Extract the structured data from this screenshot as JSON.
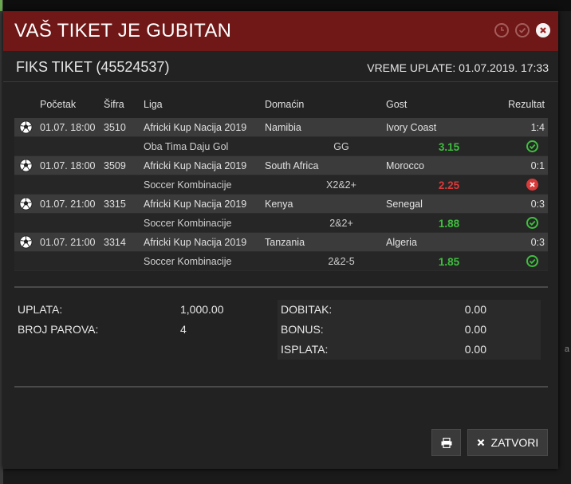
{
  "modal": {
    "title": "VAŠ TIKET JE GUBITAN",
    "ticket_label": "FIKS TIKET (45524537)",
    "payment_time": "VREME UPLATE: 01.07.2019. 17:33"
  },
  "header_icons": [
    "clock-icon",
    "check-circle-icon",
    "close-icon"
  ],
  "table": {
    "columns": {
      "start": "Početak",
      "code": "Šifra",
      "league": "Liga",
      "home": "Domaćin",
      "away": "Gost",
      "result": "Rezultat"
    },
    "matches": [
      {
        "start": "01.07. 18:00",
        "code": "3510",
        "league": "Africki Kup Nacija 2019",
        "home": "Namibia",
        "away": "Ivory Coast",
        "result": "1:4",
        "market": "Oba Tima Daju Gol",
        "tip": "GG",
        "odd": "3.15",
        "status": "win"
      },
      {
        "start": "01.07. 18:00",
        "code": "3509",
        "league": "Africki Kup Nacija 2019",
        "home": "South Africa",
        "away": "Morocco",
        "result": "0:1",
        "market": "Soccer Kombinacije",
        "tip": "X2&2+",
        "odd": "2.25",
        "status": "lose"
      },
      {
        "start": "01.07. 21:00",
        "code": "3315",
        "league": "Africki Kup Nacija 2019",
        "home": "Kenya",
        "away": "Senegal",
        "result": "0:3",
        "market": "Soccer Kombinacije",
        "tip": "2&2+",
        "odd": "1.88",
        "status": "win"
      },
      {
        "start": "01.07. 21:00",
        "code": "3314",
        "league": "Africki Kup Nacija 2019",
        "home": "Tanzania",
        "away": "Algeria",
        "result": "0:3",
        "market": "Soccer Kombinacije",
        "tip": "2&2-5",
        "odd": "1.85",
        "status": "win"
      }
    ]
  },
  "summary": {
    "stake_label": "UPLATA:",
    "stake_value": "1,000.00",
    "pairs_label": "BROJ PAROVA:",
    "pairs_value": "4",
    "win_label": "DOBITAK:",
    "win_value": "0.00",
    "bonus_label": "BONUS:",
    "bonus_value": "0.00",
    "payout_label": "ISPLATA:",
    "payout_value": "0.00"
  },
  "buttons": {
    "close_label": "ZATVORI"
  },
  "background": {
    "right_char": "a"
  },
  "colors": {
    "header": "#701717",
    "win": "#3fbf3f",
    "lose": "#d93a3a"
  }
}
